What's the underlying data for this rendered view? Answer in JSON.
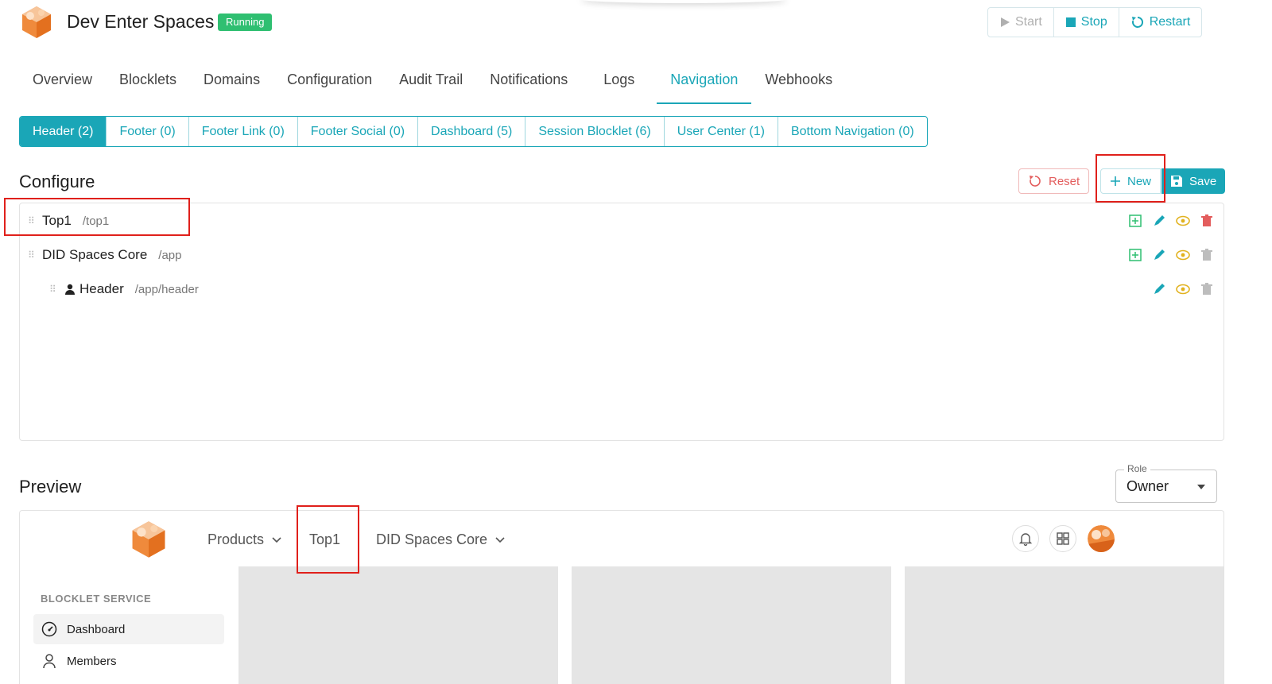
{
  "app": {
    "title": "Dev Enter Spaces",
    "status": "Running",
    "controls": {
      "start": "Start",
      "stop": "Stop",
      "restart": "Restart"
    }
  },
  "tabs": [
    {
      "label": "Overview"
    },
    {
      "label": "Blocklets"
    },
    {
      "label": "Domains"
    },
    {
      "label": "Configuration"
    },
    {
      "label": "Audit Trail"
    },
    {
      "label": "Notifications"
    },
    {
      "label": "Logs"
    },
    {
      "label": "Navigation",
      "active": true
    },
    {
      "label": "Webhooks"
    }
  ],
  "segments": [
    {
      "label": "Header (2)",
      "active": true
    },
    {
      "label": "Footer (0)"
    },
    {
      "label": "Footer Link (0)"
    },
    {
      "label": "Footer Social (0)"
    },
    {
      "label": "Dashboard (5)"
    },
    {
      "label": "Session Blocklet (6)"
    },
    {
      "label": "User Center (1)"
    },
    {
      "label": "Bottom Navigation (0)"
    }
  ],
  "configure": {
    "title": "Configure",
    "reset_label": "Reset",
    "new_label": "New",
    "save_label": "Save",
    "items": [
      {
        "name": "Top1",
        "path": "/top1"
      },
      {
        "name": "DID Spaces Core",
        "path": "/app"
      },
      {
        "name": "Header",
        "path": "/app/header"
      }
    ]
  },
  "preview": {
    "title": "Preview",
    "role_label": "Role",
    "role_value": "Owner",
    "nav": {
      "products": "Products",
      "top1": "Top1",
      "did_spaces_core": "DID Spaces Core"
    },
    "sidebar": {
      "header": "BLOCKLET SERVICE",
      "items": [
        {
          "label": "Dashboard",
          "active": true
        },
        {
          "label": "Members"
        }
      ]
    }
  },
  "colors": {
    "accent": "#1aa6b7",
    "running": "#2fbf71",
    "danger": "#e35d5d",
    "highlight": "#e0201b"
  }
}
